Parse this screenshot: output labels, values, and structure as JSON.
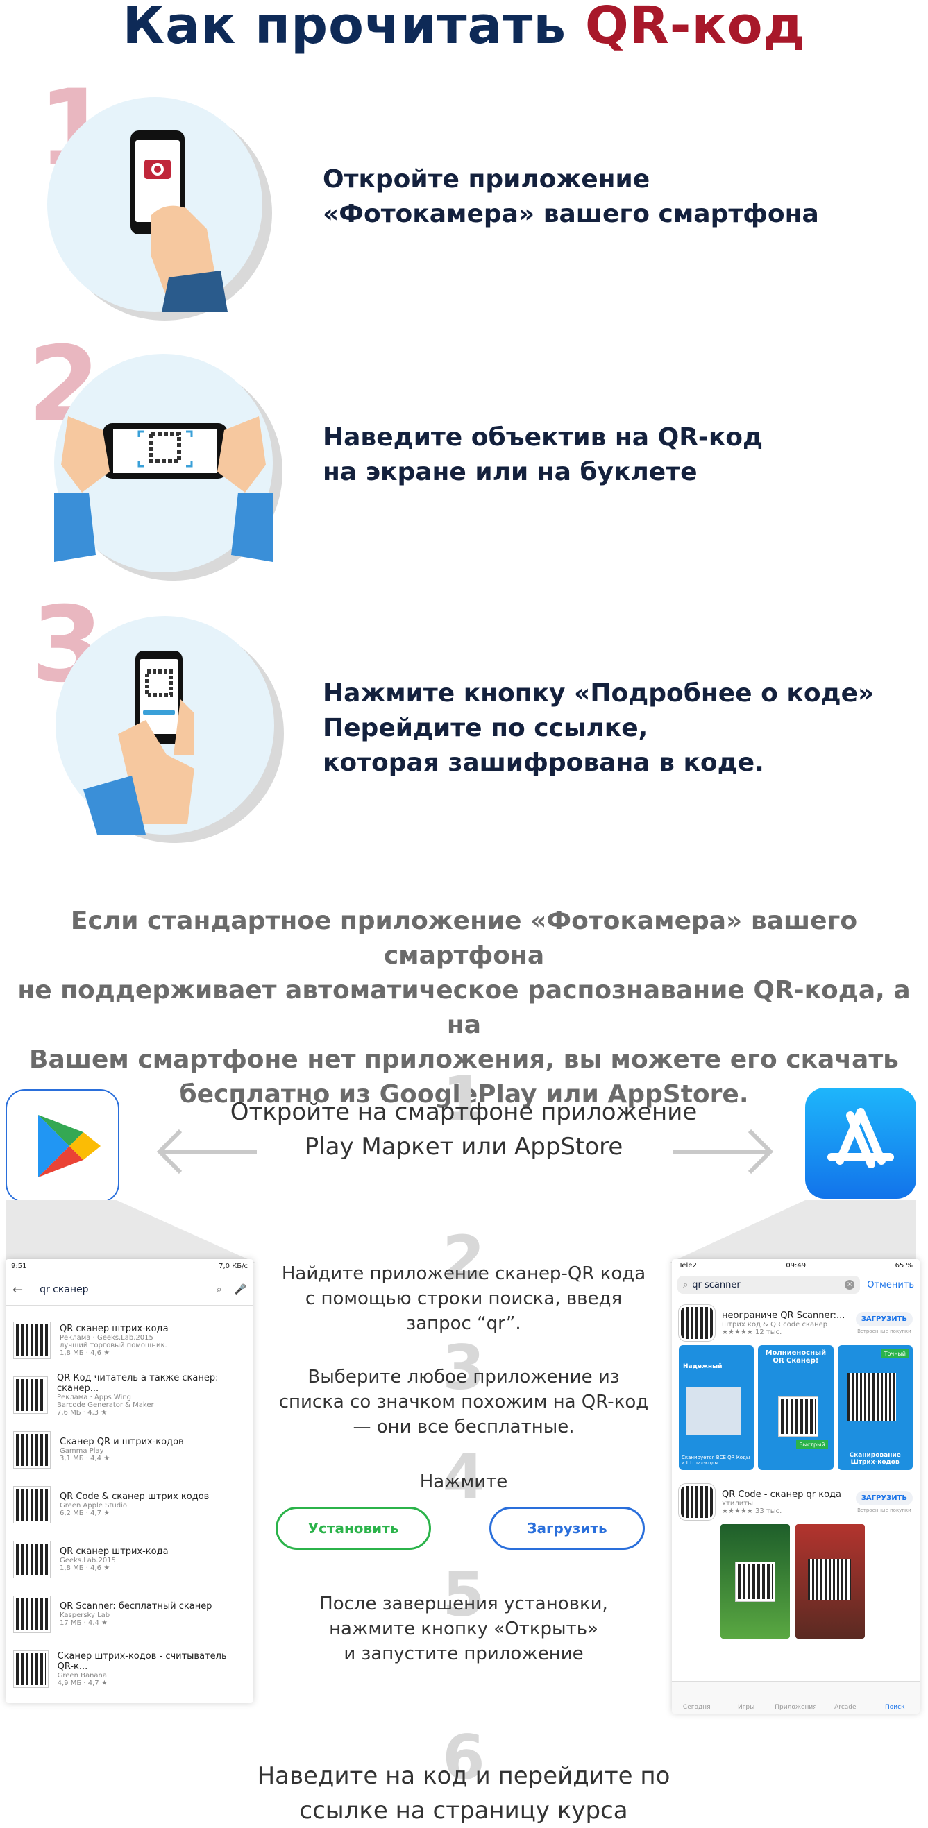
{
  "title": {
    "part1": "Как прочитать ",
    "part2": "QR-код"
  },
  "steps": [
    {
      "num": "1",
      "text": "Откройте приложение\n «Фотокамера» вашего смартфона"
    },
    {
      "num": "2",
      "text": "Наведите объектив на QR-код\nна экране или на буклете"
    },
    {
      "num": "3",
      "text": "Нажмите кнопку «Подробнее о коде»\nПерейдите по ссылке,\nкоторая зашифрована в коде."
    }
  ],
  "note": "Если стандартное приложение «Фотокамера» вашего смартфона\nне поддерживает автоматическое распознавание QR-кода, а  на\nВашем смартфоне нет приложения, вы можете его скачать\nбесплатно из GooglePlay или AppStore.",
  "guide": {
    "n1": "1",
    "t1": "Откройте на смартфоне приложение\nPlay Маркет или AppStore",
    "n2": "2",
    "t2": "Найдите приложение сканер-QR кода\nс помощью строки поиска, введя\nзапрос “qr”.",
    "n3": "3",
    "t3": "Выберите любое приложение из\nсписка со значком похожим на QR-код\n— они все бесплатные.",
    "n4": "4",
    "t4": "Нажмите",
    "install_label": "Установить",
    "download_label": "Загрузить",
    "n5": "5",
    "t5": "После завершения установки,\nнажмите кнопку «Открыть»\nи запустите приложение",
    "n6": "6",
    "t6": "Наведите на код и перейдите по\nссылке на страницу курса"
  },
  "android": {
    "time": "9:51",
    "status": "7,0 КБ/с",
    "query": "qr сканер",
    "items": [
      {
        "name": "QR сканер штрих-кода",
        "dev": "Реклама · Geeks.Lab.2015",
        "desc": "лучший торговый помощник.",
        "meta": "1,8 МБ · 4,6 ★"
      },
      {
        "name": "QR Код читатель а также сканер: сканер...",
        "dev": "Реклама · Apps Wing",
        "desc": "Barcode Generator & Maker",
        "meta": "7,6 МБ · 4,3 ★"
      },
      {
        "name": "Сканер QR и штрих-кодов",
        "dev": "Gamma Play",
        "desc": "",
        "meta": "3,1 МБ · 4,4 ★"
      },
      {
        "name": "QR Code & сканер штрих кодов",
        "dev": "Green Apple Studio",
        "desc": "",
        "meta": "6,2 МБ · 4,7 ★"
      },
      {
        "name": "QR сканер штрих-кода",
        "dev": "Geeks.Lab.2015",
        "desc": "",
        "meta": "1,8 МБ · 4,6 ★"
      },
      {
        "name": "QR Scanner: бесплатный сканер",
        "dev": "Kaspersky Lab",
        "desc": "",
        "meta": "17 МБ · 4,4 ★"
      },
      {
        "name": "Сканер штрих-кодов - считыватель QR-к...",
        "dev": "Green Banana",
        "desc": "",
        "meta": "4,9 МБ · 4,7 ★"
      }
    ]
  },
  "ios": {
    "carrier": "Tele2",
    "time": "09:49",
    "battery": "65 %",
    "query": "qr scanner",
    "cancel": "Отменить",
    "app1": {
      "name": "неограниче QR Scanner:...",
      "sub": "штрих код & QR code сканер",
      "rating": "12 тыс.",
      "btn": "ЗАГРУЗИТЬ",
      "iap": "Встроенные покупки"
    },
    "shots": [
      "Надежный",
      "Молниеносный QR Сканер!",
      "Сканирование Штрих-кодов"
    ],
    "shot_captions": [
      "Сканируется ВСЕ QR Коды и Штрих-коды",
      "Быстрый",
      "Точный"
    ],
    "app2": {
      "name": "QR Code - сканер qr кода",
      "sub": "Утилиты",
      "rating": "33 тыс.",
      "btn": "ЗАГРУЗИТЬ",
      "iap": "Встроенные покупки"
    },
    "tabs": [
      "Сегодня",
      "Игры",
      "Приложения",
      "Arcade",
      "Поиск"
    ]
  },
  "colors": {
    "navy": "#0e2a57",
    "red": "#a8182a",
    "pink": "#e9b7c0",
    "green": "#2bb34a",
    "blue": "#2a6fdb"
  }
}
